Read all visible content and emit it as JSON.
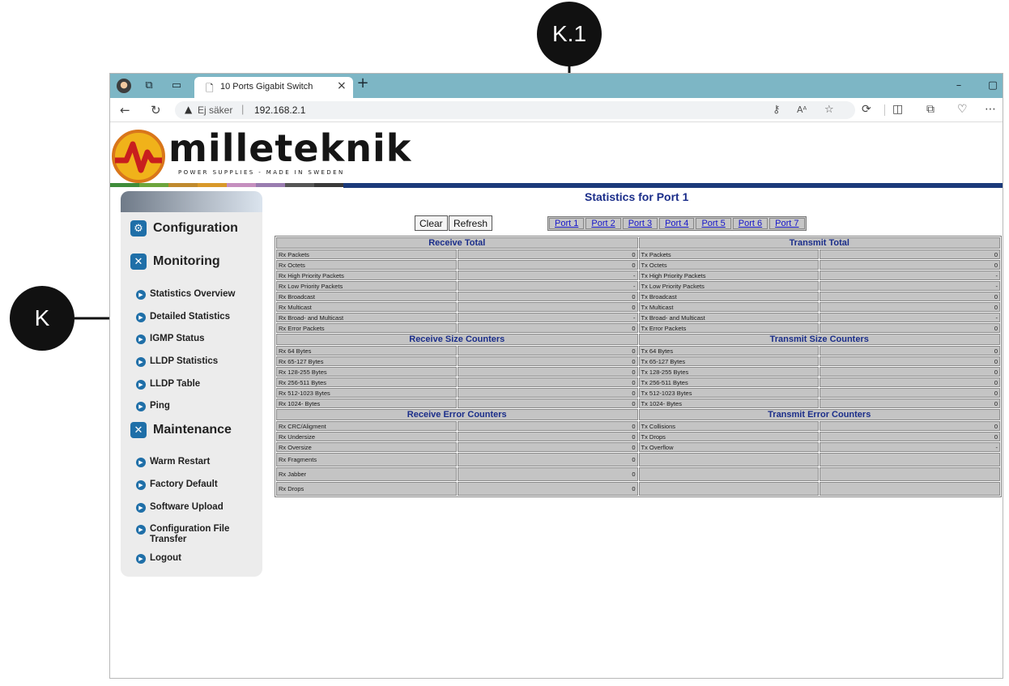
{
  "annotations": {
    "marker_k": "K",
    "marker_k1": "K.1"
  },
  "browser": {
    "tab_title": "10 Ports Gigabit Switch",
    "security_label": "Ej säker",
    "url": "192.168.2.1",
    "icons": {
      "profile": "profile-avatar-icon",
      "collections": "collections-icon",
      "tab_actions": "tab-actions-icon",
      "page": "page-icon",
      "close": "close-icon",
      "new_tab": "plus-icon",
      "back": "back-arrow-icon",
      "reload": "reload-icon",
      "warning": "warning-icon",
      "key": "key-icon",
      "read_aloud": "read-aloud-icon",
      "favorite": "star-icon",
      "extensions": "extensions-icon",
      "split_screen": "split-screen-icon",
      "more": "more-icon",
      "minimize": "minimize-icon",
      "maximize": "maximize-icon"
    }
  },
  "logo": {
    "name": "milleteknik",
    "tagline": "POWER SUPPLIES - MADE IN SWEDEN"
  },
  "colors": {
    "stripe": [
      "#3f8c3a",
      "#6da53c",
      "#c08a2e",
      "#d9992a",
      "#c58fbf",
      "#9a7cb0",
      "#565656",
      "#3a3a3a",
      "#1b3a7a"
    ],
    "accent": "#1f6fa8",
    "title": "#1b2e8a"
  },
  "sidebar": {
    "sections": {
      "configuration": "Configuration",
      "monitoring": "Monitoring",
      "maintenance": "Maintenance"
    },
    "monitoring_items": [
      "Statistics Overview",
      "Detailed Statistics",
      "IGMP Status",
      "LLDP Statistics",
      "LLDP Table",
      "Ping"
    ],
    "maintenance_items": [
      "Warm Restart",
      "Factory Default",
      "Software Upload",
      "Configuration File Transfer",
      "Logout"
    ]
  },
  "main": {
    "title": "Statistics for Port 1",
    "clear_label": "Clear",
    "refresh_label": "Refresh",
    "ports": [
      "Port 1",
      "Port 2",
      "Port 3",
      "Port 4",
      "Port 5",
      "Port 6",
      "Port 7"
    ]
  },
  "stats": {
    "receive_total": "Receive Total",
    "transmit_total": "Transmit Total",
    "receive_size": "Receive Size Counters",
    "transmit_size": "Transmit Size Counters",
    "receive_error": "Receive Error Counters",
    "transmit_error": "Transmit Error Counters",
    "total_rows": [
      [
        "Rx Packets",
        "0",
        "Tx Packets",
        "0"
      ],
      [
        "Rx Octets",
        "0",
        "Tx Octets",
        "0"
      ],
      [
        "Rx High Priority Packets",
        "-",
        "Tx High Priority Packets",
        "-"
      ],
      [
        "Rx Low Priority Packets",
        "-",
        "Tx Low Priority Packets",
        "-"
      ],
      [
        "Rx Broadcast",
        "0",
        "Tx Broadcast",
        "0"
      ],
      [
        "Rx Multicast",
        "0",
        "Tx Multicast",
        "0"
      ],
      [
        "Rx Broad- and Multicast",
        "-",
        "Tx Broad- and Multicast",
        "-"
      ],
      [
        "Rx Error Packets",
        "0",
        "Tx Error Packets",
        "0"
      ]
    ],
    "size_rows": [
      [
        "Rx 64 Bytes",
        "0",
        "Tx 64 Bytes",
        "0"
      ],
      [
        "Rx 65-127 Bytes",
        "0",
        "Tx 65-127 Bytes",
        "0"
      ],
      [
        "Rx 128-255 Bytes",
        "0",
        "Tx 128-255 Bytes",
        "0"
      ],
      [
        "Rx 256-511 Bytes",
        "0",
        "Tx 256-511 Bytes",
        "0"
      ],
      [
        "Rx 512-1023 Bytes",
        "0",
        "Tx 512-1023 Bytes",
        "0"
      ],
      [
        "Rx 1024- Bytes",
        "0",
        "Tx 1024- Bytes",
        "0"
      ]
    ],
    "error_rows": [
      [
        "Rx CRC/Aligment",
        "0",
        "Tx Collisions",
        "0"
      ],
      [
        "Rx Undersize",
        "0",
        "Tx Drops",
        "0"
      ],
      [
        "Rx Oversize",
        "0",
        "Tx Overflow",
        "-"
      ],
      [
        "Rx Fragments",
        "0",
        "",
        ""
      ],
      [
        "Rx Jabber",
        "0",
        "",
        ""
      ],
      [
        "Rx Drops",
        "0",
        "",
        ""
      ]
    ]
  }
}
